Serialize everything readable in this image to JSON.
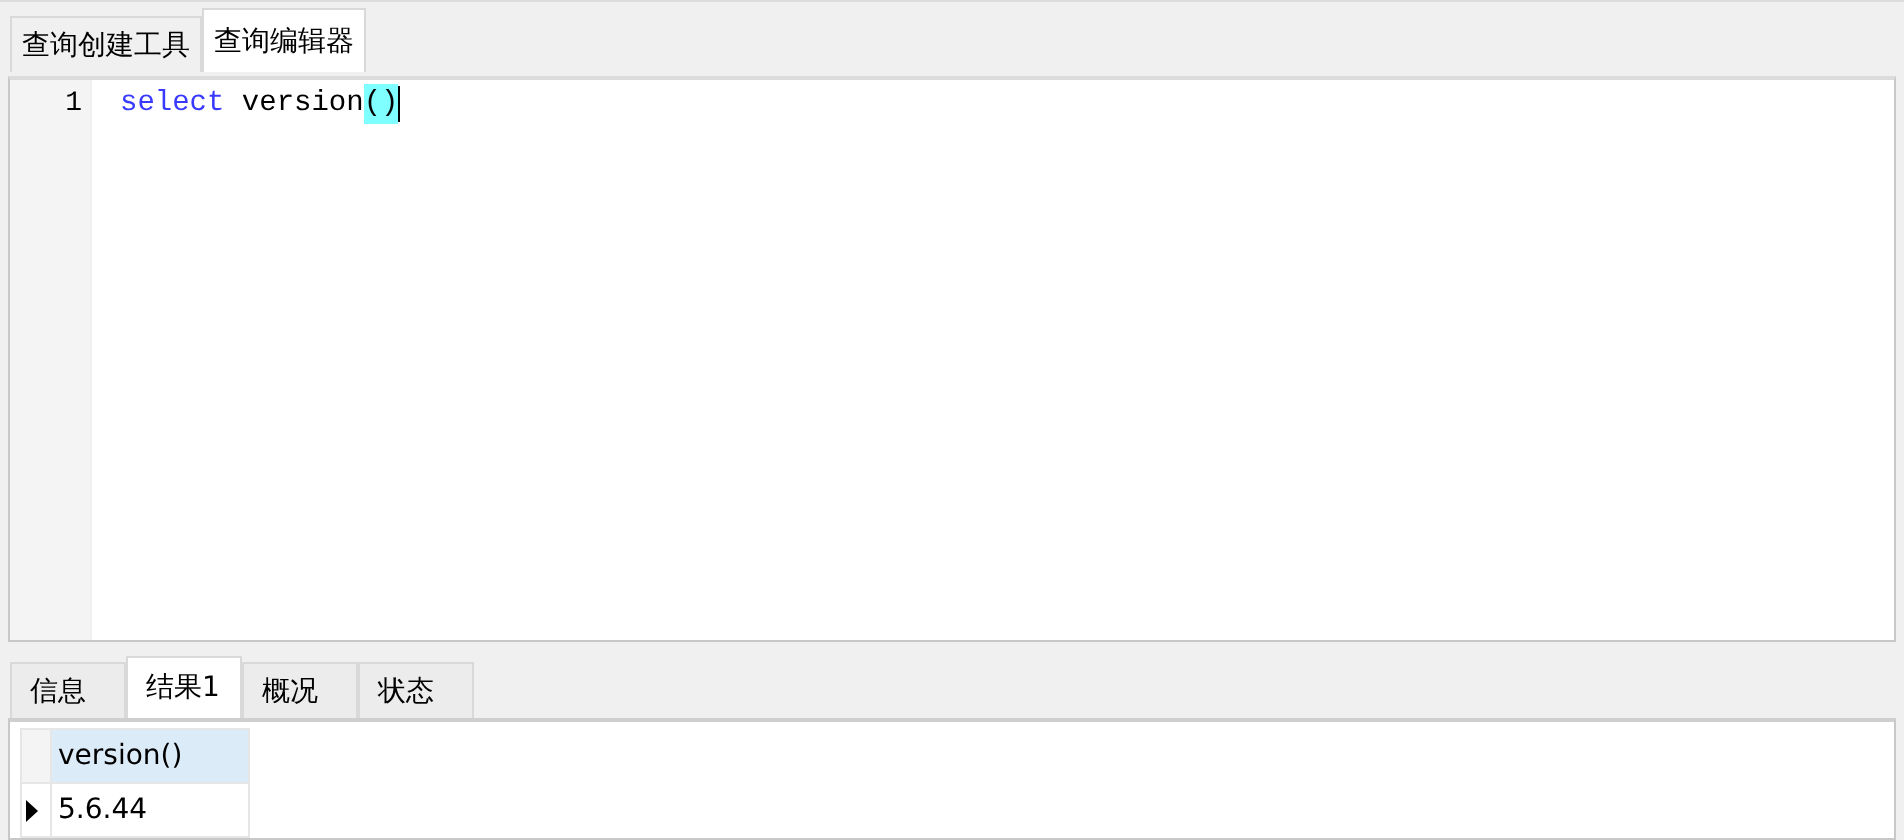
{
  "top_tabs": [
    {
      "label": "查询创建工具",
      "selected": false
    },
    {
      "label": "查询编辑器",
      "selected": true
    }
  ],
  "editor": {
    "lines": [
      {
        "number": "1",
        "tokens": [
          {
            "kind": "keyword",
            "text": "select"
          },
          {
            "kind": "plain",
            "text": " version"
          },
          {
            "kind": "match",
            "text": "()"
          }
        ]
      }
    ]
  },
  "result_tabs": [
    {
      "label": "信息",
      "selected": false
    },
    {
      "label": "结果1",
      "selected": true
    },
    {
      "label": "概况",
      "selected": false
    },
    {
      "label": "状态",
      "selected": false
    }
  ],
  "table": {
    "columns": [
      "version()"
    ],
    "rows": [
      {
        "current": true,
        "cells": [
          "5.6.44"
        ]
      }
    ]
  }
}
